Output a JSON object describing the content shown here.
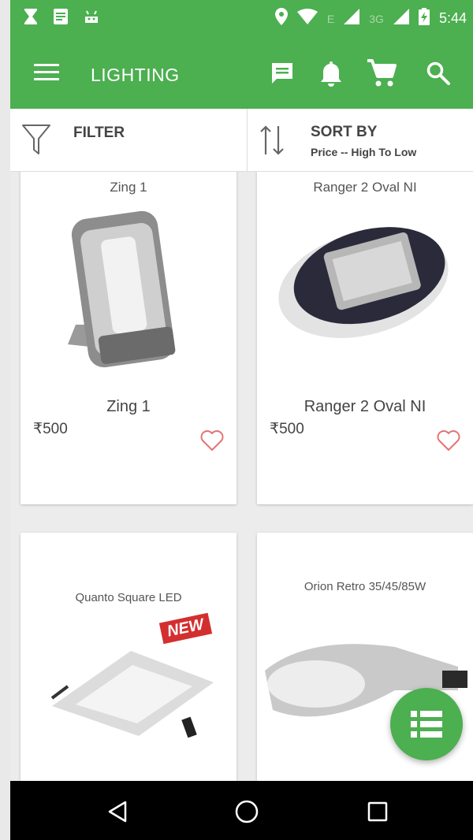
{
  "status_bar": {
    "time": "5:44",
    "network_e": "E",
    "network_3g": "3G"
  },
  "app_bar": {
    "title": "LIGHTING",
    "icons": [
      "menu-icon",
      "chat-icon",
      "bell-icon",
      "cart-icon",
      "search-icon"
    ]
  },
  "filter": {
    "label": "FILTER"
  },
  "sort": {
    "label": "SORT BY",
    "value": "Price -- High To Low"
  },
  "products": [
    {
      "image_caption": "Zing 1",
      "name": "Zing 1",
      "price": "₹500"
    },
    {
      "image_caption": "Ranger 2 Oval  NI",
      "name": "Ranger 2 Oval NI",
      "price": "₹500"
    },
    {
      "image_caption": "Quanto Square LED",
      "badge": "NEW"
    },
    {
      "image_caption": "Orion Retro 35/45/85W"
    }
  ],
  "colors": {
    "primary": "#4caf50",
    "favorite": "#e57373"
  }
}
